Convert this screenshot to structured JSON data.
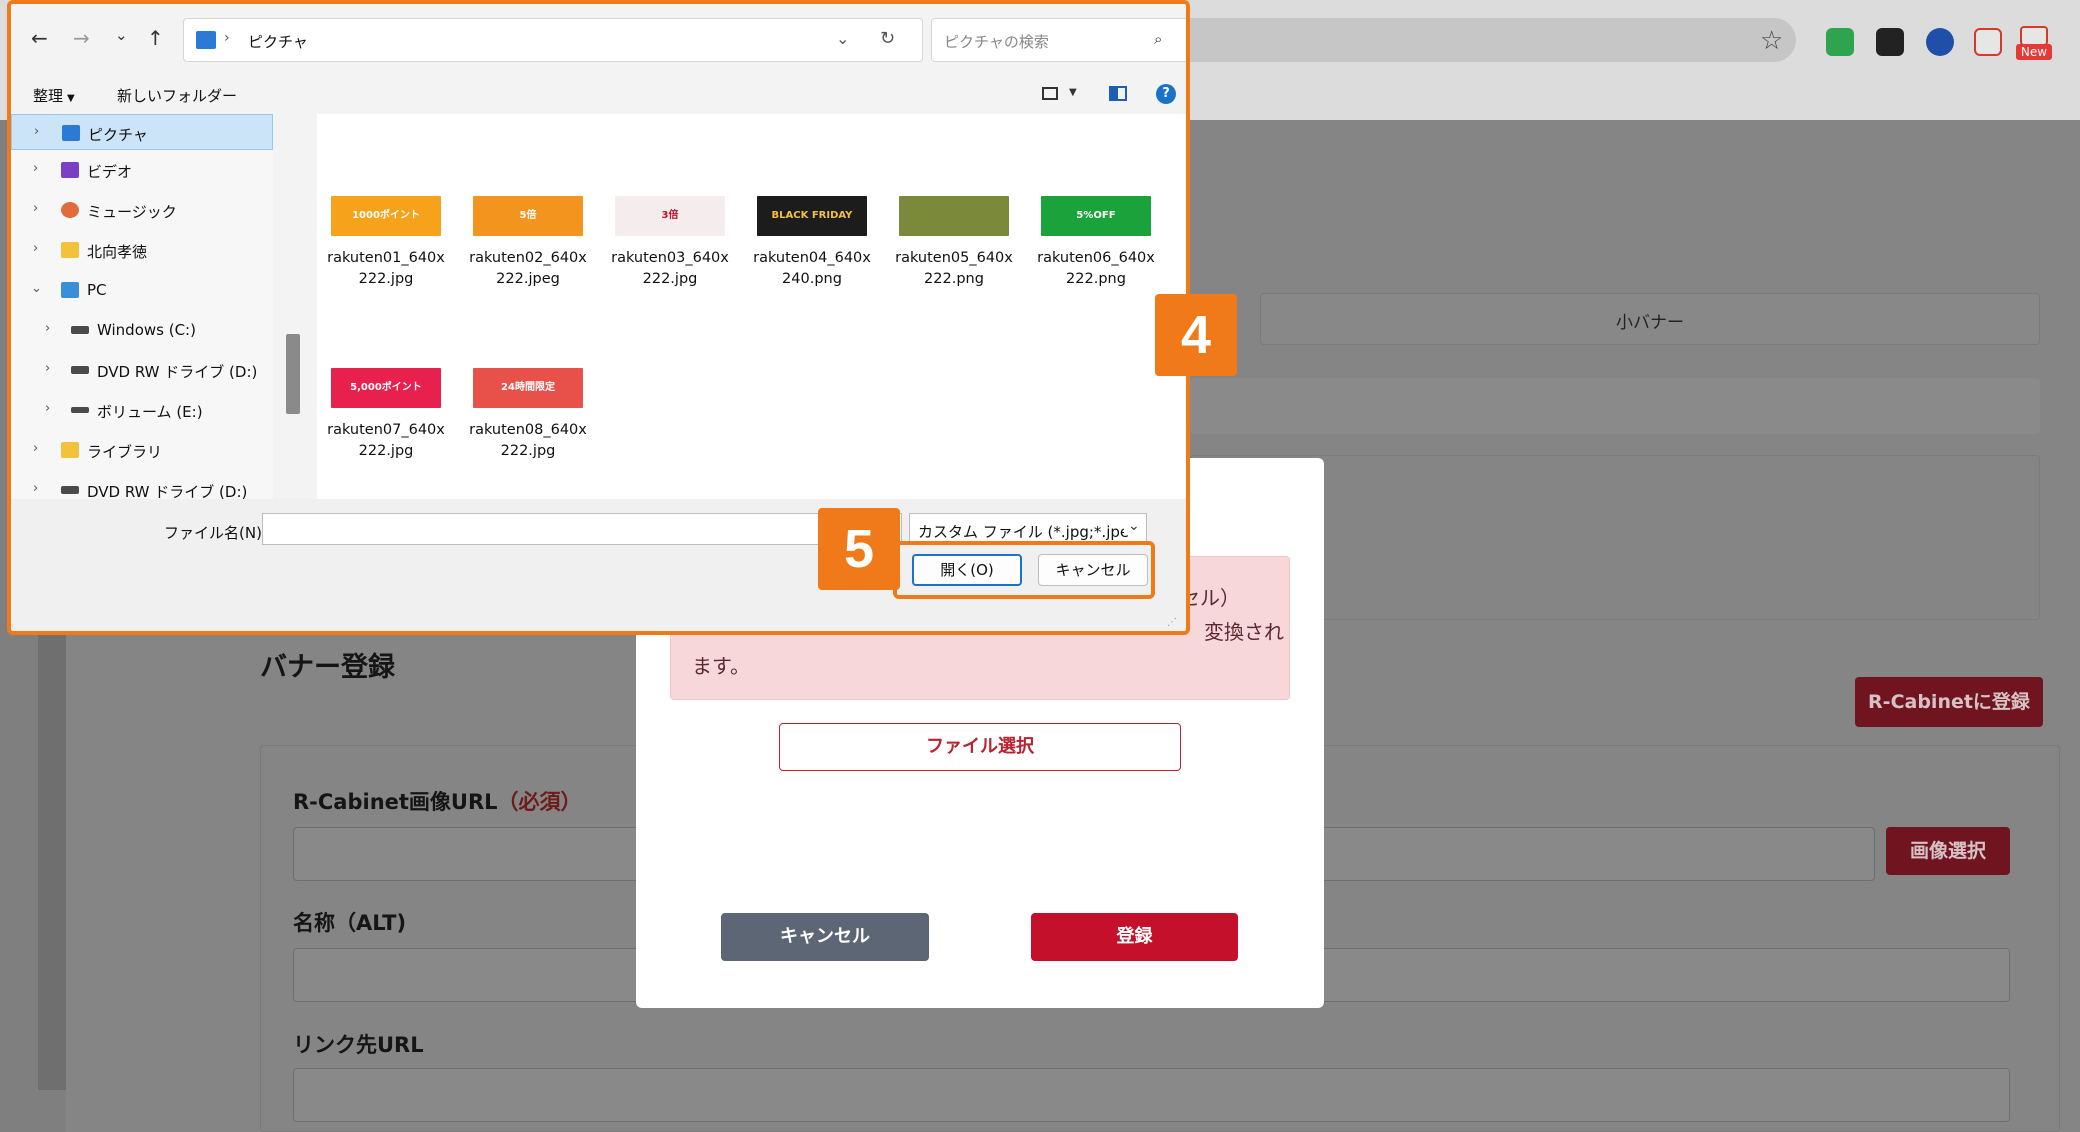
{
  "browser": {
    "extensions": [
      {
        "icon": "green-extension-icon",
        "color": "#2ea44f"
      },
      {
        "icon": "checklist-extension-icon",
        "color": "#222222"
      },
      {
        "icon": "blue-check-extension-icon",
        "color": "#1f4fa8"
      },
      {
        "icon": "translate-extension-icon",
        "color": "#d33a2c"
      },
      {
        "icon": "new-extension-icon",
        "color": "#e53935"
      }
    ],
    "new_badge": "New",
    "bookmark_icon": "star-icon"
  },
  "page": {
    "tab_small_banner": "小バナー",
    "banner_register_title": "バナー登録",
    "rcabinet_register_button": "R-Cabinetに登録",
    "form": {
      "image_url_label": "R-Cabinet画像URL",
      "image_url_required": "（必須）",
      "image_select_button": "画像選択",
      "alt_label": "名称（ALT)",
      "link_label": "リンク先URL"
    },
    "gray_panel_mark": ")"
  },
  "modal": {
    "alert_line1": "セル）",
    "alert_line2": "変換され",
    "alert_line3": "ます。",
    "file_select_button": "ファイル選択",
    "cancel_button": "キャンセル",
    "register_button": "登録"
  },
  "dialog": {
    "address_path": "ピクチャ",
    "search_placeholder": "ピクチャの検索",
    "toolbar": {
      "organize": "整理",
      "new_folder": "新しいフォルダー"
    },
    "nav_items": [
      {
        "label": "ピクチャ",
        "icon": "pictures-folder-icon",
        "color": "#2b7bd6",
        "level": 0
      },
      {
        "label": "ビデオ",
        "icon": "videos-folder-icon",
        "color": "#7b3fc4",
        "level": 0
      },
      {
        "label": "ミュージック",
        "icon": "music-folder-icon",
        "color": "#e06c3c",
        "level": 0
      },
      {
        "label": "北向孝徳",
        "icon": "user-folder-icon",
        "color": "#f2c23c",
        "level": 0
      },
      {
        "label": "PC",
        "icon": "pc-icon",
        "color": "#3a8fd9",
        "level": 0
      },
      {
        "label": "Windows (C:)",
        "icon": "drive-c-icon",
        "color": "#4a4a4a",
        "level": 1
      },
      {
        "label": "DVD RW ドライブ (D:)",
        "icon": "dvd-drive-icon",
        "color": "#4a4a4a",
        "level": 1
      },
      {
        "label": "ボリューム (E:)",
        "icon": "volume-drive-icon",
        "color": "#4a4a4a",
        "level": 1
      },
      {
        "label": "ライブラリ",
        "icon": "library-folder-icon",
        "color": "#f2c23c",
        "level": 0
      },
      {
        "label": "DVD RW ドライブ (D:)",
        "icon": "dvd-drive-icon",
        "color": "#4a4a4a",
        "level": 0
      }
    ],
    "files": [
      {
        "name_line1": "rakuten01_640x",
        "name_line2": "222.jpg",
        "thumb_text": "1000ポイント",
        "bg": "#f7a21b",
        "fg": "#ffffff"
      },
      {
        "name_line1": "rakuten02_640x",
        "name_line2": "222.jpeg",
        "thumb_text": "5倍",
        "bg": "#f3941e",
        "fg": "#ffffff"
      },
      {
        "name_line1": "rakuten03_640x",
        "name_line2": "222.jpg",
        "thumb_text": "3倍",
        "bg": "#f5ecee",
        "fg": "#c4102b"
      },
      {
        "name_line1": "rakuten04_640x",
        "name_line2": "240.png",
        "thumb_text": "BLACK FRIDAY",
        "bg": "#1c1c1c",
        "fg": "#f2c23c"
      },
      {
        "name_line1": "rakuten05_640x",
        "name_line2": "222.png",
        "thumb_text": "",
        "bg": "#7a8a3a",
        "fg": "#ffffff"
      },
      {
        "name_line1": "rakuten06_640x",
        "name_line2": "222.png",
        "thumb_text": "5%OFF",
        "bg": "#1aa33a",
        "fg": "#ffffff"
      },
      {
        "name_line1": "rakuten07_640x",
        "name_line2": "222.jpg",
        "thumb_text": "5,000ポイント",
        "bg": "#e8204e",
        "fg": "#ffffff"
      },
      {
        "name_line1": "rakuten08_640x",
        "name_line2": "222.jpg",
        "thumb_text": "24時間限定",
        "bg": "#e8504a",
        "fg": "#ffffff"
      }
    ],
    "filename_label": "ファイル名(N):",
    "filename_value": "",
    "filter_value": "カスタム ファイル (*.jpg;*.jpe",
    "open_button": "開く(O)",
    "cancel_button": "キャンセル"
  },
  "callouts": {
    "step4": "4",
    "step5": "5"
  }
}
